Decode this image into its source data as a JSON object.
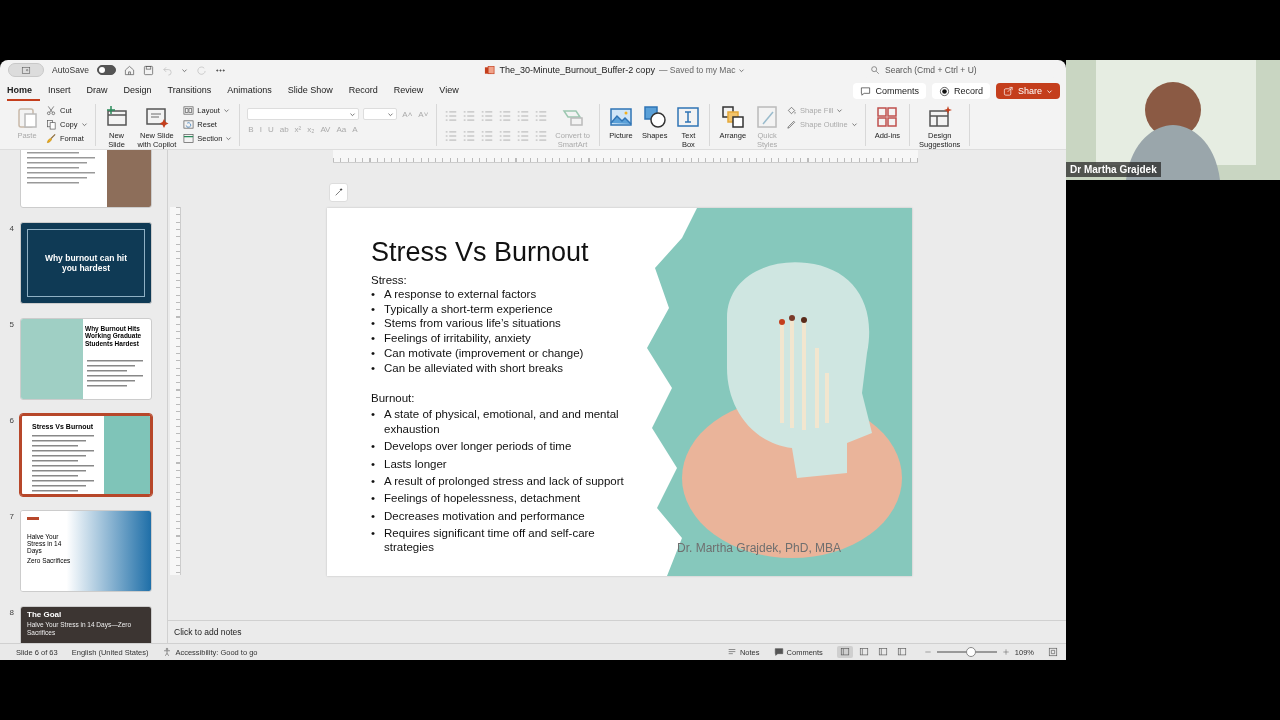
{
  "titlebar": {
    "autosave_label": "AutoSave",
    "autosave_on": false,
    "file_name": "The_30-Minute_Burnout_Buffer-2 copy",
    "save_status": "— Saved to my Mac",
    "search_placeholder": "Search (Cmd + Ctrl + U)"
  },
  "tabs": [
    {
      "label": "Home",
      "selected": true
    },
    {
      "label": "Insert",
      "selected": false
    },
    {
      "label": "Draw",
      "selected": false
    },
    {
      "label": "Design",
      "selected": false
    },
    {
      "label": "Transitions",
      "selected": false
    },
    {
      "label": "Animations",
      "selected": false
    },
    {
      "label": "Slide Show",
      "selected": false
    },
    {
      "label": "Record",
      "selected": false
    },
    {
      "label": "Review",
      "selected": false
    },
    {
      "label": "View",
      "selected": false
    }
  ],
  "header_buttons": [
    {
      "kind": "comments",
      "label": "Comments"
    },
    {
      "kind": "record",
      "label": "Record"
    },
    {
      "kind": "share",
      "label": "Share"
    }
  ],
  "ribbon": [
    {
      "items": [
        {
          "kind": "large",
          "label": "Paste",
          "disabled": true
        },
        {
          "kind": "stack",
          "items": [
            {
              "label": "Cut",
              "disabled": false,
              "dropdown": false
            },
            {
              "label": "Copy",
              "disabled": false,
              "dropdown": true
            },
            {
              "label": "Format",
              "disabled": false,
              "dropdown": false
            }
          ]
        }
      ]
    },
    {
      "items": [
        {
          "kind": "large",
          "label": "New\nSlide",
          "disabled": false
        },
        {
          "kind": "large",
          "label": "New Slide\nwith Copilot",
          "disabled": false
        },
        {
          "kind": "stack",
          "items": [
            {
              "label": "Layout",
              "disabled": false,
              "dropdown": true
            },
            {
              "label": "Reset",
              "disabled": false,
              "dropdown": false
            },
            {
              "label": "Section",
              "disabled": false,
              "dropdown": true
            }
          ]
        }
      ]
    },
    {
      "items": [
        {
          "kind": "font",
          "size_glyphs": [
            "A˄",
            "A˅"
          ],
          "format_glyphs": [
            "B",
            "I",
            "U",
            "ab",
            "x²",
            "x₂",
            "AV",
            "Aa",
            "A"
          ]
        }
      ]
    },
    {
      "items": [
        {
          "kind": "paragraph"
        },
        {
          "kind": "large",
          "label": "Convert to\nSmartArt",
          "disabled": true
        }
      ]
    },
    {
      "items": [
        {
          "kind": "large",
          "label": "Picture",
          "disabled": false
        },
        {
          "kind": "large",
          "label": "Shapes",
          "disabled": false
        },
        {
          "kind": "large",
          "label": "Text\nBox",
          "disabled": false
        }
      ]
    },
    {
      "items": [
        {
          "kind": "large",
          "label": "Arrange",
          "disabled": false
        },
        {
          "kind": "large",
          "label": "Quick\nStyles",
          "disabled": true
        },
        {
          "kind": "stack",
          "items": [
            {
              "label": "Shape Fill",
              "disabled": true,
              "dropdown": true
            },
            {
              "label": "Shape Outline",
              "disabled": true,
              "dropdown": true
            }
          ]
        }
      ]
    },
    {
      "items": [
        {
          "kind": "large",
          "label": "Add-ins",
          "disabled": false
        }
      ]
    },
    {
      "items": [
        {
          "kind": "large",
          "label": "Design\nSuggestions",
          "disabled": false
        }
      ]
    }
  ],
  "thumbnails": [
    {
      "kind": "text_photo",
      "selected": false
    },
    {
      "number": "4",
      "kind": "title_dark",
      "title": "Why burnout can hit you hardest",
      "selected": false
    },
    {
      "number": "5",
      "kind": "photo_left",
      "title": "Why Burnout Hits Working Graduate Students Hardest",
      "selected": false
    },
    {
      "number": "6",
      "kind": "teal_right",
      "title": "Stress Vs Burnout",
      "selected": true
    },
    {
      "number": "7",
      "kind": "gradient",
      "title": "Halve Your Stress in 14 Days",
      "subtitle": "Zero Sacrifices",
      "selected": false
    },
    {
      "number": "8",
      "kind": "dark_photo",
      "title": "The Goal",
      "subtitle": "Halve Your Stress in 14 Days—Zero Sacrifices",
      "selected": false
    }
  ],
  "slide": {
    "title": "Stress Vs Burnout",
    "marker": "•",
    "sections": [
      {
        "heading": "Stress:",
        "bullets": [
          "A response to external factors",
          "Typically a short-term experience",
          "Stems from various life’s situations",
          "Feelings of irritability, anxiety",
          "Can motivate (improvement or change)",
          "Can be alleviated with short breaks"
        ]
      },
      {
        "heading": "Burnout:",
        "bullets": [
          "A state of physical, emotional, and and mental exhaustion",
          "Develops over longer periods of time",
          "Lasts longer",
          "A result of prolonged stress and lack of support",
          "Feelings of hopelessness, detachment",
          "Decreases motivation and performance",
          "Requires significant time off and self-care strategies"
        ]
      }
    ],
    "footer": "Dr. Martha Grajdek, PhD, MBA"
  },
  "notes": {
    "placeholder": "Click to add notes"
  },
  "status_bar": {
    "slide_position": "Slide 6 of 63",
    "language": "English (United States)",
    "accessibility": "Accessibility: Good to go",
    "notes_label": "Notes",
    "comments_label": "Comments",
    "views": [
      {
        "selected": true
      },
      {
        "selected": false
      },
      {
        "selected": false
      },
      {
        "selected": false
      }
    ],
    "zoom": {
      "level": 0.55,
      "reading": "109%"
    }
  },
  "webcam": {
    "name": "Dr Martha Grajdek"
  }
}
